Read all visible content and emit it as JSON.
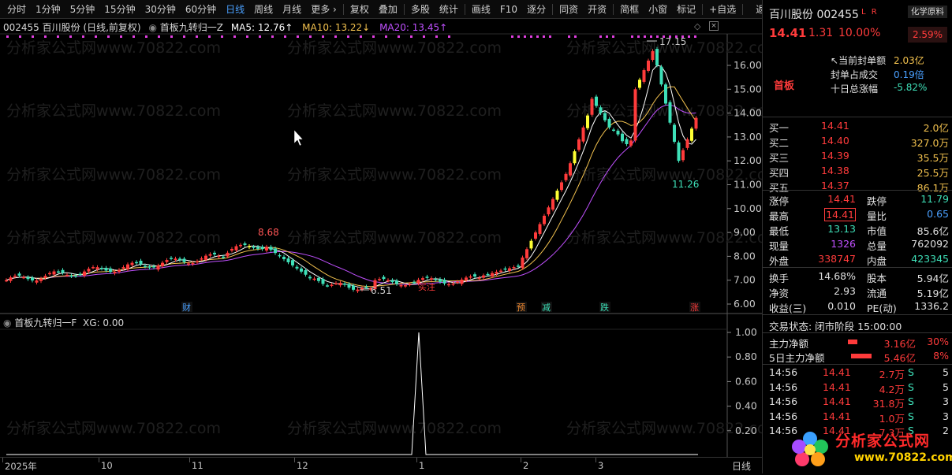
{
  "toolbar": {
    "items": [
      "分时",
      "1分钟",
      "5分钟",
      "15分钟",
      "30分钟",
      "60分钟",
      "日线",
      "周线",
      "月线",
      "更多 ›",
      "复权",
      "叠加",
      "多股",
      "统计",
      "画线",
      "F10",
      "逐分",
      "同资",
      "开资",
      "简框",
      "小窗",
      "标记",
      "+自选",
      "返回"
    ],
    "active": "日线"
  },
  "chart_header": {
    "code_name": "002455 百川股份 (日线,前复权)",
    "indicator": "首板九转归一Z",
    "ma5": "MA5: 12.76↑",
    "ma10": "MA10: 13.22↓",
    "ma20": "MA20: 13.45↑"
  },
  "subchart_header": {
    "indicator": "首板九转归一F",
    "xg": "XG: 0.00"
  },
  "watermark": "分析家公式网www.70822.com",
  "price_axis": [
    "16.00",
    "15.00",
    "14.00",
    "13.00",
    "12.00",
    "11.00",
    "10.00",
    "9.00",
    "8.00",
    "7.00",
    "6.00"
  ],
  "sub_axis": [
    "1.00",
    "0.80",
    "0.60",
    "0.40",
    "0.20"
  ],
  "date_axis": [
    {
      "label": "2025年"
    },
    {
      "label": "10"
    },
    {
      "label": "11"
    },
    {
      "label": "12"
    },
    {
      "label": "1"
    },
    {
      "label": "2"
    },
    {
      "label": "3"
    }
  ],
  "period_label": "日线",
  "annotations": {
    "high": "17.15",
    "peak_b": "8.68",
    "low_a": "6.51",
    "low_b": "11.26",
    "note1": "买注"
  },
  "markers": [
    {
      "text": "财",
      "color": "#4aa0ff"
    },
    {
      "text": "预",
      "color": "#f28a30"
    },
    {
      "text": "减",
      "color": "#3ee0b8"
    },
    {
      "text": "跌",
      "color": "#3ee0b8"
    },
    {
      "text": "涨",
      "color": "#ff3b3b"
    }
  ],
  "quote": {
    "name": "百川股份 002455",
    "badge": "L R",
    "tag": "化学原料",
    "price": "14.41",
    "change": "1.31",
    "change_pct": "10.00%",
    "side_pct": "2.59%",
    "seal_amount_label": "当前封单额",
    "seal_amount": "2.03亿",
    "seal_ratio_label": "封单占成交",
    "seal_ratio": "0.19倍",
    "ten_day_label": "十日总涨幅",
    "ten_day": "-5.82%",
    "board": "首板"
  },
  "order_book": [
    {
      "label": "买一",
      "price": "14.41",
      "vol": "2.0亿"
    },
    {
      "label": "买二",
      "price": "14.40",
      "vol": "327.0万"
    },
    {
      "label": "买三",
      "price": "14.39",
      "vol": "35.5万"
    },
    {
      "label": "买四",
      "price": "14.38",
      "vol": "25.5万"
    },
    {
      "label": "买五",
      "price": "14.37",
      "vol": "86.1万"
    }
  ],
  "stats": [
    {
      "l1": "涨停",
      "v1": "14.41",
      "l2": "跌停",
      "v2": "11.79"
    },
    {
      "l1": "最高",
      "v1": "14.41",
      "l2": "量比",
      "v2": "0.65"
    },
    {
      "l1": "最低",
      "v1": "13.13",
      "l2": "市值",
      "v2": "85.6亿"
    },
    {
      "l1": "现量",
      "v1": "1326",
      "l2": "总量",
      "v2": "762092"
    },
    {
      "l1": "外盘",
      "v1": "338747",
      "l2": "内盘",
      "v2": "423345"
    }
  ],
  "stats2": [
    {
      "l1": "换手",
      "v1": "14.68%",
      "l2": "股本",
      "v2": "5.94亿"
    },
    {
      "l1": "净资",
      "v1": "2.93",
      "l2": "流通",
      "v2": "5.19亿"
    },
    {
      "l1": "收益(三)",
      "v1": "0.010",
      "l2": "PE(动)",
      "v2": "1336.2"
    }
  ],
  "trade_status": "交易状态: 闭市阶段 15:00:00",
  "capital": [
    {
      "label": "主力净额",
      "value": "3.16亿",
      "pct": "30%"
    },
    {
      "label": "5日主力净额",
      "value": "5.46亿",
      "pct": "8%"
    }
  ],
  "ticks": [
    {
      "time": "14:56",
      "price": "14.41",
      "vol": "2.7万",
      "side": "S",
      "n": "5"
    },
    {
      "time": "14:56",
      "price": "14.41",
      "vol": "4.2万",
      "side": "S",
      "n": "5"
    },
    {
      "time": "14:56",
      "price": "14.41",
      "vol": "31.8万",
      "side": "S",
      "n": "3"
    },
    {
      "time": "14:56",
      "price": "14.41",
      "vol": "1.0万",
      "side": "S",
      "n": "3"
    },
    {
      "time": "14:56",
      "price": "14.41",
      "vol": "7.3万",
      "side": "S",
      "n": "2"
    }
  ],
  "logo": {
    "title": "分析家公式网",
    "url": "www.70822.com"
  },
  "colors": {
    "up": "#ff3b3b",
    "down": "#3ee0b8",
    "limit": "#ffff33",
    "ma5": "#ffffff",
    "ma10": "#f2c14e",
    "ma20": "#c050ff"
  }
}
